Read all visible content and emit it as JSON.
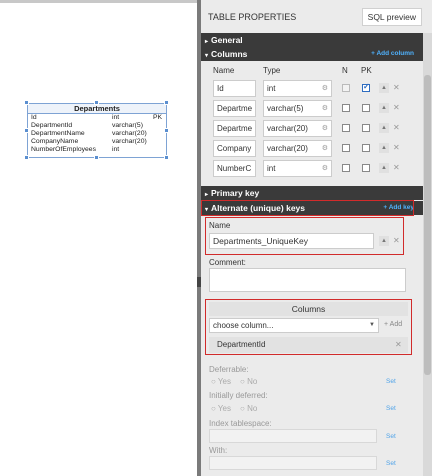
{
  "entity": {
    "title": "Departments",
    "rows": [
      {
        "name": "Id",
        "type": "int",
        "key": "PK"
      },
      {
        "name": "DepartmentId",
        "type": "varchar(5)",
        "key": ""
      },
      {
        "name": "DepartmentName",
        "type": "varchar(20)",
        "key": ""
      },
      {
        "name": "CompanyName",
        "type": "varchar(20)",
        "key": ""
      },
      {
        "name": "NumberOfEmployees",
        "type": "int",
        "key": ""
      }
    ]
  },
  "panel": {
    "title": "TABLE PROPERTIES",
    "sql_preview": "SQL preview"
  },
  "sections": {
    "general": "General",
    "columns": "Columns",
    "columns_add": "+ Add column",
    "primary_key": "Primary key",
    "alternate_keys": "Alternate (unique) keys",
    "alternate_add": "+ Add key"
  },
  "columns_table": {
    "headers": {
      "name": "Name",
      "type": "Type",
      "n": "N",
      "pk": "PK"
    },
    "rows": [
      {
        "name": "Id",
        "type": "int",
        "n": false,
        "n_disabled": true,
        "pk": true
      },
      {
        "name": "Departme",
        "type": "varchar(5)",
        "n": false,
        "n_disabled": false,
        "pk": false
      },
      {
        "name": "Departme",
        "type": "varchar(20)",
        "n": false,
        "n_disabled": false,
        "pk": false
      },
      {
        "name": "Company",
        "type": "varchar(20)",
        "n": false,
        "n_disabled": false,
        "pk": false
      },
      {
        "name": "NumberC",
        "type": "int",
        "n": false,
        "n_disabled": false,
        "pk": false
      }
    ]
  },
  "alt_key": {
    "name_label": "Name",
    "name_value": "Departments_UniqueKey",
    "comment_label": "Comment:",
    "columns_header": "Columns",
    "choose_placeholder": "choose column...",
    "add_label": "+ Add",
    "selected_column": "DepartmentId",
    "deferrable_label": "Deferrable:",
    "initially_deferred_label": "Initially deferred:",
    "yes": "Yes",
    "no": "No",
    "index_tablespace_label": "Index tablespace:",
    "with_label": "With:",
    "set": "Set"
  }
}
